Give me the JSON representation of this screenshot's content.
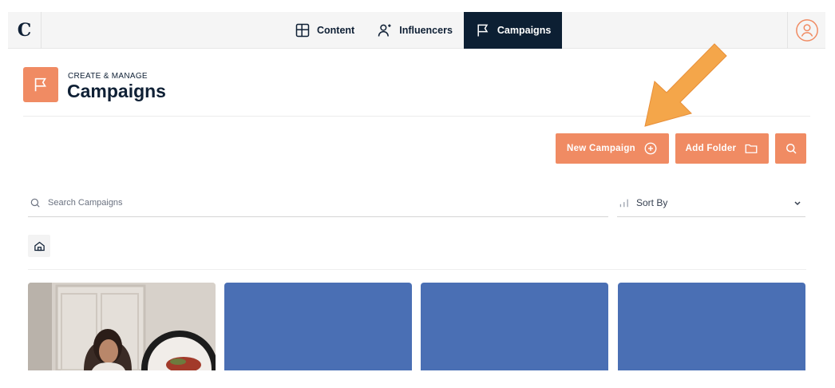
{
  "app": {
    "logo_letter": "C"
  },
  "nav": {
    "items": [
      {
        "label": "Content",
        "icon": "layout-grid-icon",
        "active": false
      },
      {
        "label": "Influencers",
        "icon": "user-plus-icon",
        "active": false
      },
      {
        "label": "Campaigns",
        "icon": "flag-icon",
        "active": true
      }
    ],
    "profile_icon": "user-circle-icon"
  },
  "header": {
    "eyebrow": "CREATE & MANAGE",
    "title": "Campaigns",
    "icon": "flag-icon"
  },
  "actions": {
    "new_campaign": "New Campaign",
    "add_folder": "Add Folder"
  },
  "search": {
    "placeholder": "Search Campaigns"
  },
  "sort": {
    "label": "Sort By"
  },
  "cards": [
    {
      "type": "photo"
    },
    {
      "type": "placeholder"
    },
    {
      "type": "placeholder"
    },
    {
      "type": "placeholder"
    }
  ],
  "colors": {
    "accent": "#f08b63",
    "nav_active": "#0c1f33",
    "card_blue": "#4a6fb4",
    "annotation_arrow": "#f4a64a"
  }
}
